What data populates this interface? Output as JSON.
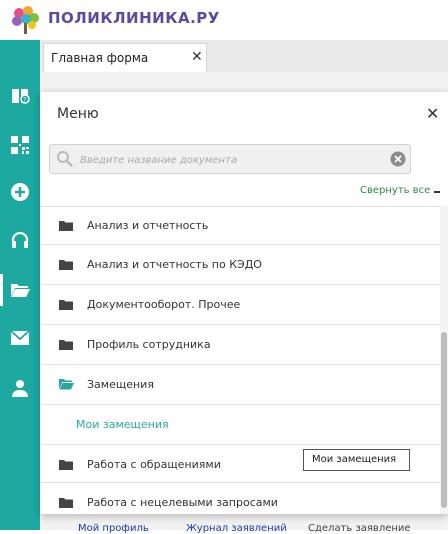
{
  "brand": {
    "logo_text": "ПОЛИКЛИНИКА.РУ"
  },
  "sidebar": {
    "icons": [
      {
        "name": "book-help-icon"
      },
      {
        "name": "qr-code-icon"
      },
      {
        "name": "plus-circle-icon"
      },
      {
        "name": "headset-icon"
      },
      {
        "name": "folder-open-icon",
        "active": true
      },
      {
        "name": "mail-icon"
      },
      {
        "name": "user-icon"
      }
    ]
  },
  "tabs": [
    {
      "label": "Главная форма",
      "close": "✕"
    }
  ],
  "menu": {
    "title": "Меню",
    "close": "✕",
    "search": {
      "placeholder": "Введите название документа"
    },
    "collapse_label": "Свернуть все",
    "items": [
      {
        "label": "Анализ и отчетность",
        "icon": "folder-icon"
      },
      {
        "label": "Анализ и отчетность по КЭДО",
        "icon": "folder-icon"
      },
      {
        "label": "Документооборот. Прочее",
        "icon": "folder-icon"
      },
      {
        "label": "Профиль сотрудника",
        "icon": "folder-icon"
      },
      {
        "label": "Замещения",
        "icon": "folder-open-icon",
        "expanded": true
      },
      {
        "label": "Мои замещения",
        "sub": true
      },
      {
        "label": "Работа с обращениями",
        "icon": "folder-icon"
      },
      {
        "label": "Работа с нецелевыми запросами",
        "icon": "folder-icon"
      }
    ]
  },
  "tooltip": {
    "text": "Мои замещения"
  },
  "bottom": {
    "link1": "Мой профиль",
    "link2": "Журнал заявлений",
    "text": "Сделать заявление"
  },
  "colors": {
    "sidebar": "#1ea9a0",
    "accent": "#2aa6a0",
    "collapse": "#2e8a4a"
  }
}
